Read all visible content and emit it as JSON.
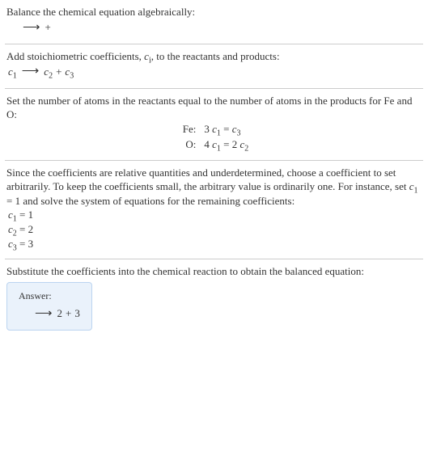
{
  "section1": {
    "title": "Balance the chemical equation algebraically:",
    "eq_lhs_gap": "",
    "arrow": "⟶",
    "plus": "+"
  },
  "section2": {
    "title_a": "Add stoichiometric coefficients, ",
    "title_var": "c",
    "title_var_sub": "i",
    "title_b": ", to the reactants and products:",
    "c1": "c",
    "c1s": "1",
    "arrow": "⟶",
    "c2": "c",
    "c2s": "2",
    "plus": "+",
    "c3": "c",
    "c3s": "3"
  },
  "section3": {
    "title": "Set the number of atoms in the reactants equal to the number of atoms in the products for Fe and O:",
    "rows": [
      {
        "label": "Fe:",
        "lhs_coef": "3 ",
        "lhs_c": "c",
        "lhs_sub": "1",
        "eq": " = ",
        "rhs_coef": "",
        "rhs_c": "c",
        "rhs_sub": "3"
      },
      {
        "label": "O:",
        "lhs_coef": "4 ",
        "lhs_c": "c",
        "lhs_sub": "1",
        "eq": " = ",
        "rhs_coef": "2 ",
        "rhs_c": "c",
        "rhs_sub": "2"
      }
    ]
  },
  "section4": {
    "title_a": "Since the coefficients are relative quantities and underdetermined, choose a coefficient to set arbitrarily. To keep the coefficients small, the arbitrary value is ordinarily one. For instance, set ",
    "set_c": "c",
    "set_sub": "1",
    "set_eq": " = 1",
    "title_b": " and solve the system of equations for the remaining coefficients:",
    "lines": [
      {
        "c": "c",
        "sub": "1",
        "val": " = 1"
      },
      {
        "c": "c",
        "sub": "2",
        "val": " = 2"
      },
      {
        "c": "c",
        "sub": "3",
        "val": " = 3"
      }
    ]
  },
  "section5": {
    "title": "Substitute the coefficients into the chemical reaction to obtain the balanced equation:",
    "answer_label": "Answer:",
    "arrow": "⟶",
    "coef_a": "2",
    "plus": "+",
    "coef_b": "3"
  }
}
